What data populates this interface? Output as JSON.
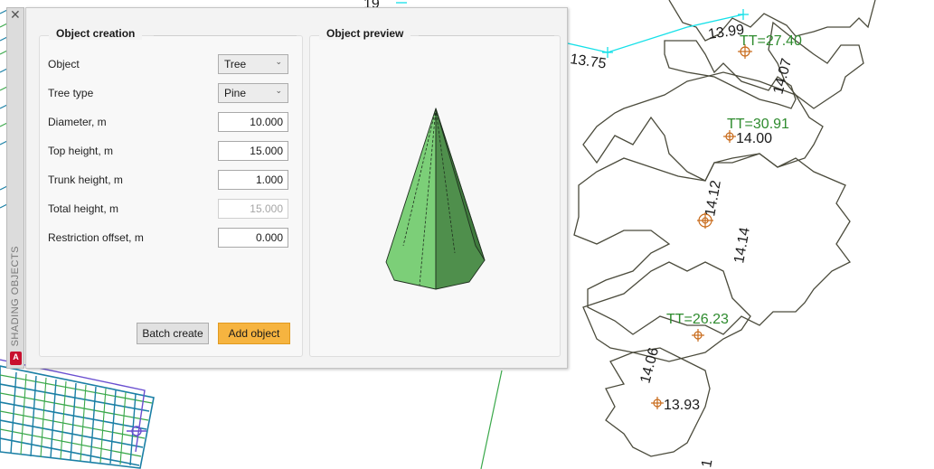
{
  "drawing": {
    "labels": [
      "13.99",
      "TT=27.40",
      "13.75",
      "14.07",
      "TT=30.91",
      "14.00",
      "14.12",
      "14.14",
      "TT=26.23",
      "14.06",
      "13.93",
      "19",
      "1"
    ],
    "colors": {
      "tree_outline": "#4b4b3c",
      "cyan_line": "#15e0e8",
      "green_text": "#2e8b2e",
      "marker": "#c86a1a",
      "grid_blue": "#1a7fa5",
      "grid_green": "#3aa84a",
      "grid_purple": "#6a4fd0"
    }
  },
  "palette": {
    "title": "SHADING OBJECTS",
    "close_icon": "close-icon",
    "app_badge": "A"
  },
  "creation": {
    "title": "Object creation",
    "object_label": "Object",
    "object_value": "Tree",
    "tree_type_label": "Tree type",
    "tree_type_value": "Pine",
    "diameter_label": "Diameter, m",
    "diameter_value": "10.000",
    "top_height_label": "Top height, m",
    "top_height_value": "15.000",
    "trunk_height_label": "Trunk height, m",
    "trunk_height_value": "1.000",
    "total_height_label": "Total height, m",
    "total_height_value": "15.000",
    "restriction_label": "Restriction offset, m",
    "restriction_value": "0.000",
    "batch_button": "Batch create",
    "add_button": "Add object",
    "accent_color": "#f6b440"
  },
  "preview": {
    "title": "Object preview",
    "colors": {
      "light": "#7ccf78",
      "mid": "#5caf5a",
      "dark": "#3f7a3d",
      "edge": "#1f2f1f"
    }
  }
}
